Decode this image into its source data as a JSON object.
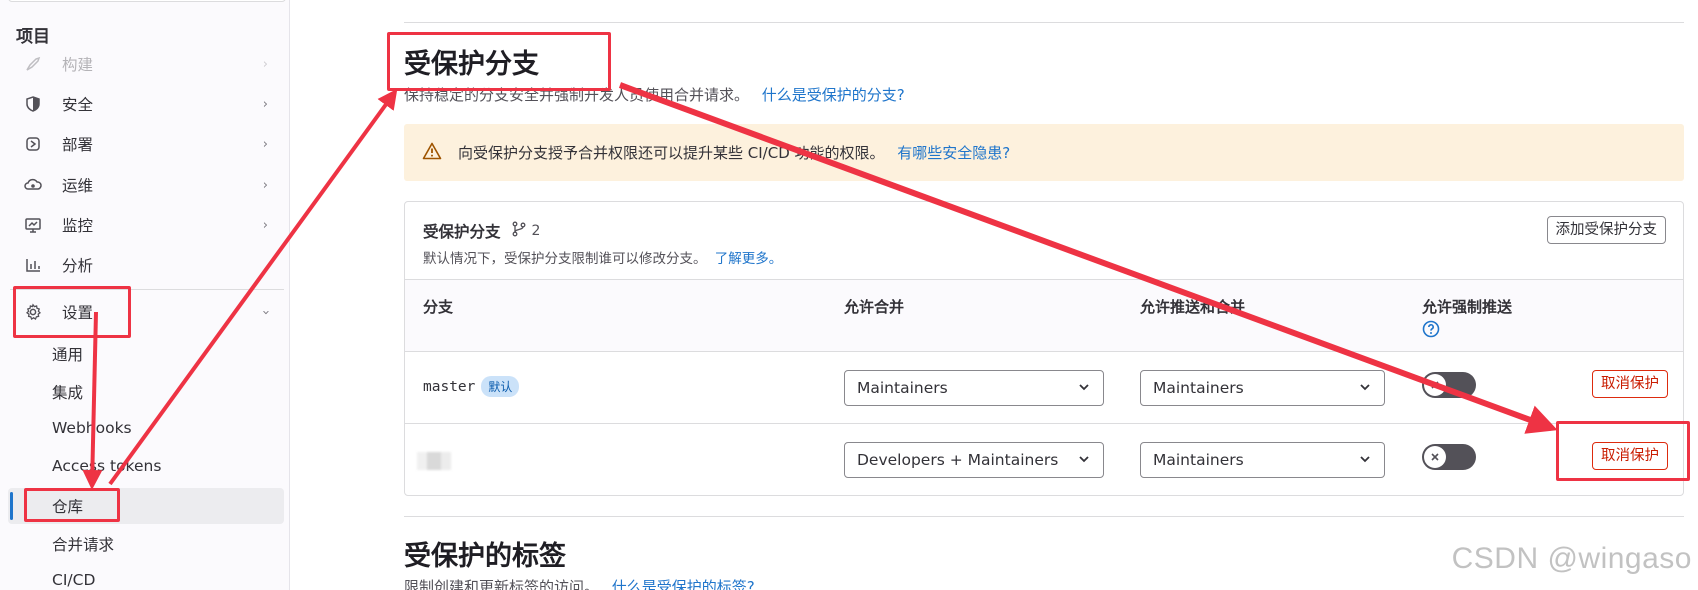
{
  "sidebar": {
    "section_title": "项目",
    "items": [
      {
        "label": "构建",
        "icon": "rocket-icon"
      },
      {
        "label": "安全",
        "icon": "shield-icon"
      },
      {
        "label": "部署",
        "icon": "deploy-icon"
      },
      {
        "label": "运维",
        "icon": "cloud-gear-icon"
      },
      {
        "label": "监控",
        "icon": "monitor-icon"
      },
      {
        "label": "分析",
        "icon": "chart-icon"
      },
      {
        "label": "设置",
        "icon": "gear-icon"
      }
    ],
    "settings_sub": [
      "通用",
      "集成",
      "Webhooks",
      "Access tokens",
      "仓库",
      "合并请求",
      "CI/CD"
    ]
  },
  "protected_branches": {
    "title": "受保护分支",
    "desc": "保持稳定的分支安全并强制开发人员使用合并请求。",
    "help_link": "什么是受保护的分支?",
    "alert_text": "向受保护分支授予合并权限还可以提升某些 CI/CD 功能的权限。",
    "alert_link": "有哪些安全隐患?",
    "card": {
      "title": "受保护分支",
      "count": "2",
      "sub": "默认情况下，受保护分支限制谁可以修改分支。",
      "sub_link": "了解更多。",
      "add_button": "添加受保护分支",
      "columns": [
        "分支",
        "允许合并",
        "允许推送和合并",
        "允许强制推送"
      ],
      "rows": [
        {
          "branch": "master",
          "badge": "默认",
          "merge": "Maintainers",
          "push": "Maintainers",
          "force_push": false,
          "action": "取消保护"
        },
        {
          "branch": "",
          "badge": "",
          "merge": "Developers + Maintainers",
          "push": "Maintainers",
          "force_push": false,
          "action": "取消保护"
        }
      ]
    }
  },
  "protected_tags": {
    "title": "受保护的标签",
    "desc": "限制创建和更新标签的访问。",
    "help_link": "什么是受保护的标签?"
  },
  "watermark": "CSDN @wingaso",
  "colors": {
    "link": "#1f75cb",
    "annotation": "#ee3344",
    "alert_bg": "#fdf1dd",
    "danger": "#dd2b0e"
  }
}
